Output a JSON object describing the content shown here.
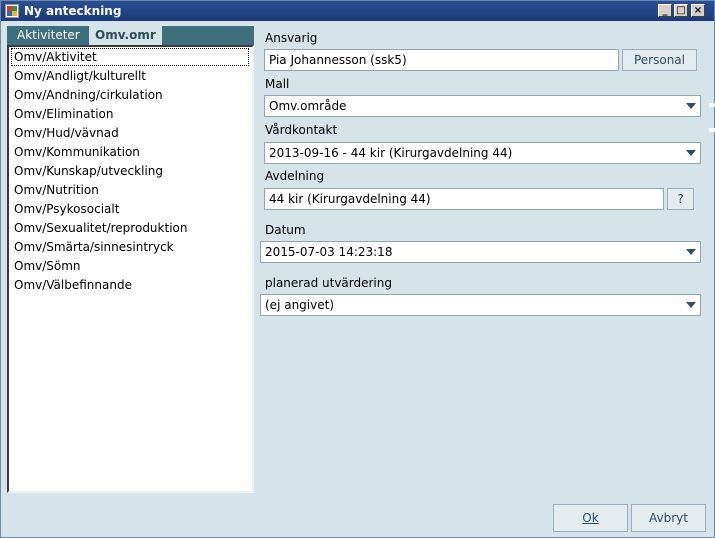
{
  "window": {
    "title": "Ny anteckning"
  },
  "tabs": [
    {
      "label": "Aktiviteter",
      "active": false
    },
    {
      "label": "Omv.omr",
      "active": true
    }
  ],
  "list": {
    "items": [
      "Omv/Aktivitet",
      "Omv/Andligt/kulturellt",
      "Omv/Andning/cirkulation",
      "Omv/Elimination",
      "Omv/Hud/vävnad",
      "Omv/Kommunikation",
      "Omv/Kunskap/utveckling",
      "Omv/Nutrition",
      "Omv/Psykosocialt",
      "Omv/Sexualitet/reproduktion",
      "Omv/Smärta/sinnesintryck",
      "Omv/Sömn",
      "Omv/Välbefinnande"
    ],
    "selected_index": 0
  },
  "form": {
    "ansvarig_label": "Ansvarig",
    "ansvarig_value": "Pia Johannesson (ssk5)",
    "personal_button": "Personal",
    "mall_label": "Mall",
    "mall_value": "Omv.område",
    "vardkontakt_label": "Vårdkontakt",
    "vardkontakt_value": "2013-09-16 -  44 kir (Kirurgavdelning 44)",
    "avdelning_label": "Avdelning",
    "avdelning_value": "44 kir (Kirurgavdelning 44)",
    "avdelning_button": "?",
    "datum_label": "Datum",
    "datum_value": "2015-07-03 14:23:18",
    "planerad_label": "planerad utvärdering",
    "planerad_value": "(ej angivet)"
  },
  "footer": {
    "ok_label": "Ok",
    "avbryt_label": "Avbryt"
  }
}
